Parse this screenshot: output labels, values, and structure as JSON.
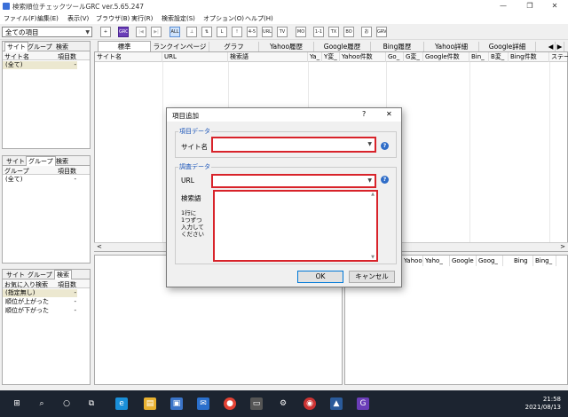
{
  "window": {
    "title": "検索順位チェックツールGRC  ver.5.65.247",
    "minimize": "—",
    "maximize": "❐",
    "close": "✕"
  },
  "menu": [
    "ファイル(F)",
    "編集(E)",
    "表示(V)",
    "ブラウザ(B)",
    "実行(R)",
    "検索設定(S)",
    "オプション(O)",
    "ヘルプ(H)"
  ],
  "toolbar": {
    "filter_value": "全ての項目",
    "buttons": [
      "+",
      "GRC",
      "|◀",
      "▶|",
      "ALL",
      "⊥",
      "⇅",
      "L",
      "!",
      "4-5",
      "URL",
      "TV RE",
      "MO",
      "1-1",
      "TX",
      "BO",
      "お",
      "GRV"
    ]
  },
  "left_panel_1": {
    "tabs": [
      "サイト",
      "グループ",
      "検索"
    ],
    "active": "サイト",
    "col_name": "サイト名",
    "col_count": "項目数",
    "rows": [
      {
        "name": "(全て)",
        "count": "-"
      }
    ]
  },
  "left_panel_2": {
    "tabs": [
      "サイト",
      "グループ",
      "検索"
    ],
    "active": "グループ",
    "col_name": "グループ",
    "col_count": "項目数",
    "rows": [
      {
        "name": "(全て)",
        "count": "-"
      }
    ]
  },
  "left_panel_3": {
    "tabs": [
      "サイト",
      "グループ",
      "検索"
    ],
    "active": "検索",
    "col_name": "お気に入り検索",
    "col_count": "項目数",
    "rows": [
      {
        "name": "(指定無し)",
        "count": "-"
      },
      {
        "name": "順位が上がった",
        "count": "-"
      },
      {
        "name": "順位が下がった",
        "count": "-"
      }
    ]
  },
  "main_tabs": [
    "標準",
    "ランクインページ",
    "グラフ",
    "Yahoo履歴",
    "Google履歴",
    "Bing履歴",
    "Yahoo詳細",
    "Google詳細"
  ],
  "tab_scroll": [
    "◀",
    "▶"
  ],
  "grid_columns": [
    "サイト名",
    "URL",
    "検索語",
    "Ya_",
    "Y変_",
    "Yahoo件数",
    "Go_",
    "G変_",
    "Google件数",
    "Bin_",
    "B変_",
    "Bing件数",
    "ステー"
  ],
  "bottom_right_columns": [
    "Yahoo",
    "Yaho_",
    "Google",
    "Goog_",
    "Bing",
    "Bing_"
  ],
  "dialog": {
    "title": "項目追加",
    "help_mark": "?",
    "close": "✕",
    "group_item": "項目データ",
    "site_label": "サイト名",
    "site_value": "",
    "group_survey": "調査データ",
    "url_label": "URL",
    "url_value": "",
    "keywords_label": "検索語",
    "keywords_hint": "1行に\n1つずつ\n入力して\nください",
    "ok": "OK",
    "cancel": "キャンセル"
  },
  "taskbar": {
    "time": "21:58",
    "date": "2021/08/13"
  }
}
